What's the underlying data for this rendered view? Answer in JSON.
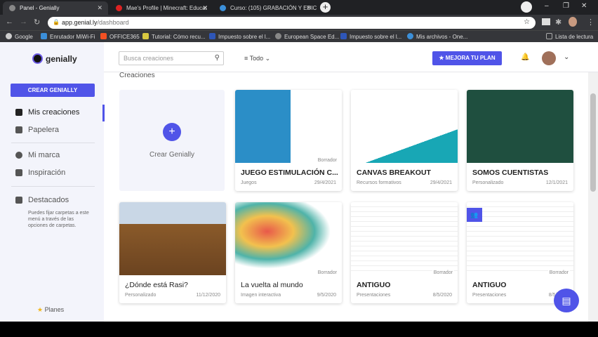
{
  "browser": {
    "tabs": [
      {
        "label": "Panel - Genially"
      },
      {
        "label": "Mae's Profile | Minecraft: Educat"
      },
      {
        "label": "Curso: (105) GRABACIÓN Y EDIC"
      }
    ],
    "url_host": "app.genial.ly",
    "url_path": "/dashboard",
    "bookmarks": [
      "Google",
      "Enrutador MiWi-Fi",
      "OFFICE365",
      "Tutorial: Cómo recu...",
      "Impuesto sobre el l...",
      "European Space Ed...",
      "Impuesto sobre el l...",
      "Mis archivos - One..."
    ],
    "reading_list": "Lista de lectura"
  },
  "sidebar": {
    "logo": "genially",
    "create": "CREAR GENIALLY",
    "items": [
      {
        "label": "Mis creaciones"
      },
      {
        "label": "Papelera"
      },
      {
        "label": "Mi marca"
      },
      {
        "label": "Inspiración"
      },
      {
        "label": "Destacados"
      }
    ],
    "hint": "Puedes fijar carpetas a este menú a través de las opciones de carpetas.",
    "planes": "Planes"
  },
  "header": {
    "search_placeholder": "Busca creaciones",
    "filter": "Todo",
    "upgrade": "MEJORA TU PLAN"
  },
  "main": {
    "section": "Creaciones",
    "new_label": "Crear Genially",
    "draft": "Borrador",
    "cards": [
      {
        "title": "JUEGO ESTIMULACIÓN C...",
        "category": "Juegos",
        "date": "29/4/2021"
      },
      {
        "title": "CANVAS BREAKOUT",
        "category": "Recursos formativos",
        "date": "29/4/2021"
      },
      {
        "title": "SOMOS CUENTISTAS",
        "category": "Personalizado",
        "date": "12/1/2021"
      },
      {
        "title": "¿Dónde está Rasi?",
        "category": "Personalizado",
        "date": "11/12/2020"
      },
      {
        "title": "La vuelta al mundo",
        "category": "Imagen interactiva",
        "date": "9/5/2020"
      },
      {
        "title": "ANTIGUO",
        "category": "Presentaciones",
        "date": "8/5/2020"
      },
      {
        "title": "ANTIGUO",
        "category": "Presentaciones",
        "date": "8/5/2020"
      }
    ]
  }
}
